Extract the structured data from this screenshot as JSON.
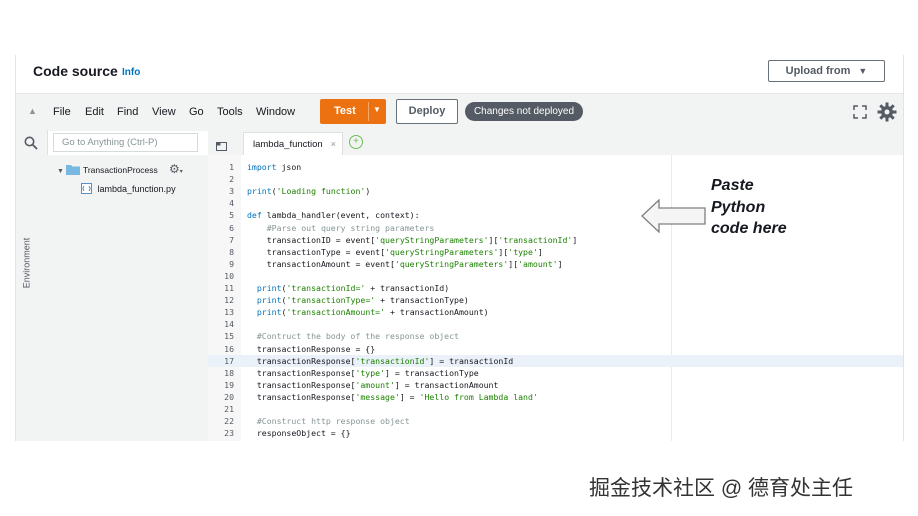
{
  "header": {
    "title": "Code source",
    "info_link": "Info",
    "upload_button": "Upload from"
  },
  "menubar": {
    "items": [
      "File",
      "Edit",
      "Find",
      "View",
      "Go",
      "Tools",
      "Window"
    ],
    "test_button": "Test",
    "deploy_button": "Deploy",
    "status_badge": "Changes not deployed"
  },
  "sidebar": {
    "search_placeholder": "Go to Anything (Ctrl-P)",
    "environment_tab": "Environment",
    "folder": "TransactionProcess",
    "file": "lambda_function.py"
  },
  "editor": {
    "active_tab": "lambda_function",
    "lines": [
      {
        "n": "1",
        "code": "import json"
      },
      {
        "n": "2",
        "code": ""
      },
      {
        "n": "3",
        "code": "print('Loading function')"
      },
      {
        "n": "4",
        "code": ""
      },
      {
        "n": "5",
        "code": "def lambda_handler(event, context):"
      },
      {
        "n": "6",
        "code": "    #Parse out query string parameters"
      },
      {
        "n": "7",
        "code": "    transactionID = event['queryStringParameters']['transactionId']"
      },
      {
        "n": "8",
        "code": "    transactionType = event['queryStringParameters']['type']"
      },
      {
        "n": "9",
        "code": "    transactionAmount = event['queryStringParameters']['amount']"
      },
      {
        "n": "10",
        "code": ""
      },
      {
        "n": "11",
        "code": "  print('transactionId=' + transactionId)"
      },
      {
        "n": "12",
        "code": "  print('transactionType=' + transactionType)"
      },
      {
        "n": "13",
        "code": "  print('transactionAmount=' + transactionAmount)"
      },
      {
        "n": "14",
        "code": ""
      },
      {
        "n": "15",
        "code": "  #Contruct the body of the response object"
      },
      {
        "n": "16",
        "code": "  transactionResponse = {}"
      },
      {
        "n": "17",
        "code": "  transactionResponse['transactionId'] = transactionId"
      },
      {
        "n": "18",
        "code": "  transactionResponse['type'] = transactionType"
      },
      {
        "n": "19",
        "code": "  transactionResponse['amount'] = transactionAmount"
      },
      {
        "n": "20",
        "code": "  transactionResponse['message'] = 'Hello from Lambda land'"
      },
      {
        "n": "21",
        "code": ""
      },
      {
        "n": "22",
        "code": "  #Construct http response object"
      },
      {
        "n": "23",
        "code": "  responseObject = {}"
      }
    ],
    "highlighted_line": "17"
  },
  "annotation": {
    "line1": "Paste",
    "line2": "Python",
    "line3": "code here"
  },
  "watermark": "掘金技术社区 @ 德育处主任",
  "colors": {
    "accent": "#ec7211",
    "link": "#0073bb",
    "badge": "#545b64"
  }
}
